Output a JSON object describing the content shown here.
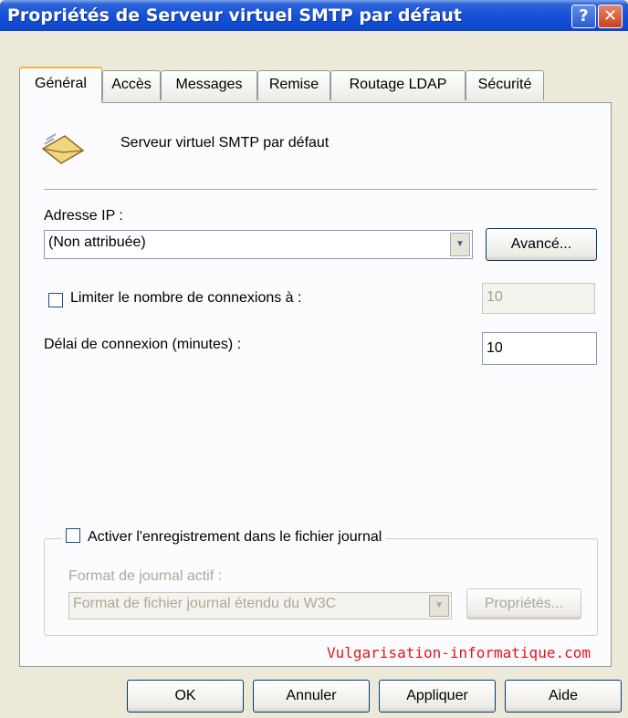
{
  "window": {
    "title": "Propriétés de Serveur virtuel SMTP par défaut",
    "help_label": "?",
    "close_label": "✕"
  },
  "tabs": [
    {
      "label": "Général",
      "active": true
    },
    {
      "label": "Accès"
    },
    {
      "label": "Messages"
    },
    {
      "label": "Remise"
    },
    {
      "label": "Routage LDAP"
    },
    {
      "label": "Sécurité"
    }
  ],
  "general": {
    "icon": "envelope-icon",
    "server_name": "Serveur virtuel SMTP par défaut",
    "ip_label": "Adresse IP :",
    "ip_value": "(Non attribuée)",
    "advanced_button": "Avancé...",
    "limit_label": "Limiter le nombre de connexions à :",
    "limit_value": "10",
    "timeout_label": "Délai de connexion (minutes) :",
    "timeout_value": "10",
    "logging": {
      "enable_label": "Activer l'enregistrement dans le fichier journal",
      "format_label": "Format de journal actif :",
      "format_value": "Format de fichier journal étendu du W3C",
      "properties_button": "Propriétés..."
    }
  },
  "watermark": "Vulgarisation-informatique.com",
  "footer": {
    "ok": "OK",
    "cancel": "Annuler",
    "apply": "Appliquer",
    "help": "Aide"
  }
}
